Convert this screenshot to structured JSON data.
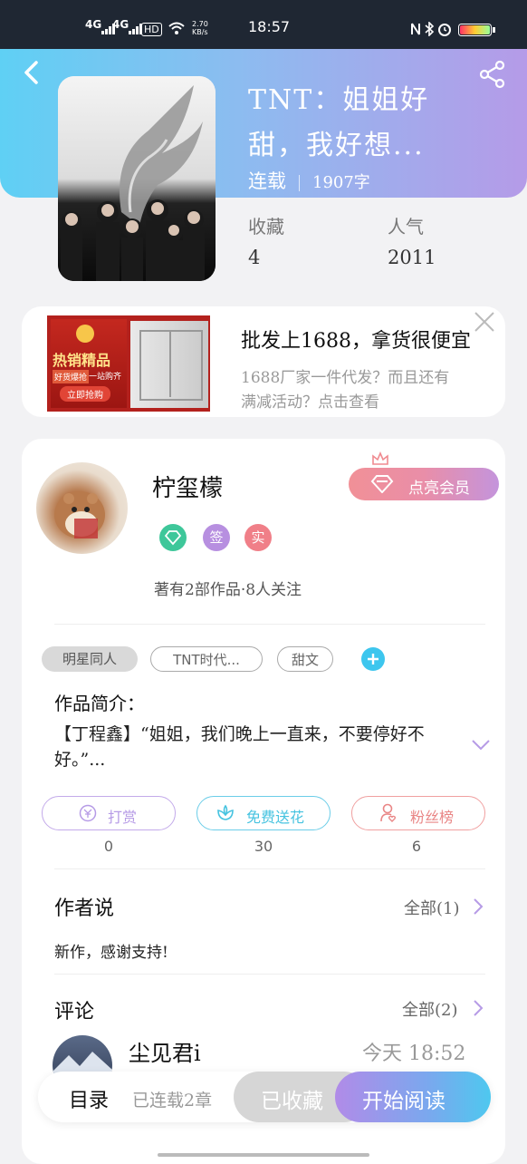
{
  "status_bar": {
    "network1": "4G",
    "network2": "4G",
    "hd": "HD",
    "speed": "2.70\nKB/s",
    "time": "18:57"
  },
  "book": {
    "title_line1": "TNT：姐姐好",
    "title_line2": "甜，我好想...",
    "status": "连载",
    "word_count": "1907字",
    "favorites_label": "收藏",
    "favorites_value": "4",
    "popularity_label": "人气",
    "popularity_value": "2011"
  },
  "ad": {
    "image_text1": "热销精品",
    "image_text2": "好货爆抢",
    "image_text3": "一站购齐",
    "image_text4": "立即抢购",
    "title": "批发上1688，拿货很便宜",
    "desc_line1": "1688厂家一件代发？而且还有",
    "desc_line2": "满减活动？点击查看"
  },
  "author": {
    "name": "柠玺檬",
    "vip_label": "点亮会员",
    "badge2": "签",
    "badge3": "实",
    "works_line": "著有2部作品·8人关注"
  },
  "tags": [
    "明星同人",
    "TNT时代...",
    "甜文"
  ],
  "intro": {
    "label": "作品简介：",
    "text": "【丁程鑫】“姐姐，我们晚上一直来，不要停好不好。”..."
  },
  "actions": [
    {
      "label": "打赏",
      "count": "0",
      "color": "#b69be6"
    },
    {
      "label": "免费送花",
      "count": "30",
      "color": "#46c3e0"
    },
    {
      "label": "粉丝榜",
      "count": "6",
      "color": "#ee8c8c"
    }
  ],
  "author_says": {
    "title": "作者说",
    "more": "全部(1)",
    "text": "新作，感谢支持!"
  },
  "comments": {
    "title": "评论",
    "more": "全部(2)",
    "first_user": "尘见君i",
    "first_time": "今天 18:52"
  },
  "bottom_bar": {
    "catalog": "目录",
    "chapters": "已连载2章",
    "collected": "已收藏",
    "read": "开始阅读"
  }
}
